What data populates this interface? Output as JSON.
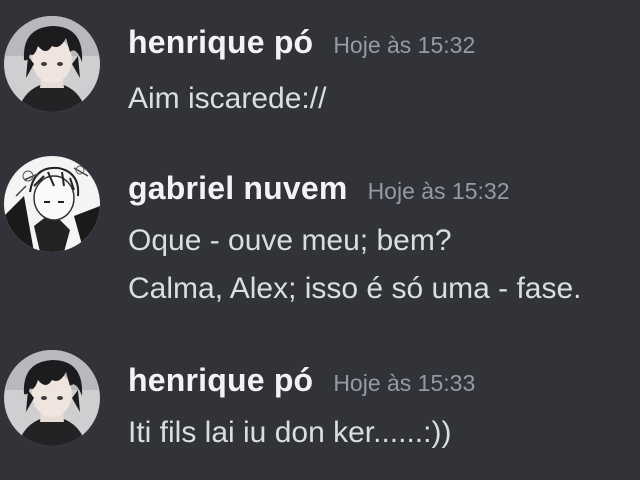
{
  "messages": [
    {
      "author": "henrique pó",
      "timestamp": "Hoje às 15:32",
      "avatar_icon": "dark-haired-anime-avatar-icon",
      "lines": [
        "Aim iscarede://"
      ]
    },
    {
      "author": "gabriel nuvem",
      "timestamp": "Hoje às 15:32",
      "avatar_icon": "manga-sketch-avatar-icon",
      "lines": [
        "Oque - ouve meu; bem?",
        "Calma, Alex; isso é só uma - fase."
      ]
    },
    {
      "author": "henrique pó",
      "timestamp": "Hoje às 15:33",
      "avatar_icon": "dark-haired-anime-avatar-icon",
      "lines": [
        "Iti fils lai iu don ker......:))"
      ]
    }
  ],
  "colors": {
    "background": "#313338",
    "username": "#f2f3f5",
    "timestamp": "#949ba4",
    "message_text": "#dbdee1"
  }
}
